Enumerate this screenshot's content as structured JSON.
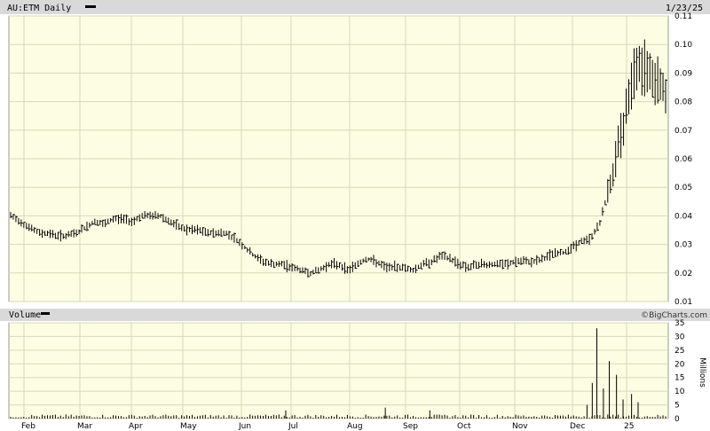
{
  "header": {
    "title": "AU:ETM Daily",
    "date": "1/23/25",
    "volume_label": "Volume",
    "brand": "©BigCharts.com"
  },
  "colors": {
    "plot_bg": "#fdfde3",
    "grid": "#d8d8b8",
    "bar_band": "#d8d8d8",
    "price_bar": "#000000"
  },
  "chart_data": [
    {
      "type": "ohlc",
      "title": "AU:ETM Daily",
      "grid": true,
      "y_axis_side": "right",
      "ylim": [
        0.01,
        0.11
      ],
      "yticks": [
        "0.01",
        "0.02",
        "0.03",
        "0.04",
        "0.05",
        "0.06",
        "0.07",
        "0.08",
        "0.09",
        "0.10",
        "0.11"
      ],
      "xticks": [
        "Feb",
        "Mar",
        "Apr",
        "May",
        "Jun",
        "Jul",
        "Aug",
        "Sep",
        "Oct",
        "Nov",
        "Dec",
        "25"
      ],
      "weekly_close": [
        0.04,
        0.038,
        0.036,
        0.034,
        0.034,
        0.033,
        0.033,
        0.034,
        0.036,
        0.038,
        0.037,
        0.039,
        0.039,
        0.038,
        0.04,
        0.04,
        0.04,
        0.038,
        0.036,
        0.035,
        0.035,
        0.034,
        0.034,
        0.034,
        0.032,
        0.029,
        0.026,
        0.024,
        0.023,
        0.023,
        0.022,
        0.021,
        0.02,
        0.021,
        0.023,
        0.023,
        0.021,
        0.023,
        0.025,
        0.024,
        0.022,
        0.022,
        0.022,
        0.021,
        0.023,
        0.024,
        0.026,
        0.025,
        0.023,
        0.022,
        0.023,
        0.023,
        0.023,
        0.023,
        0.024,
        0.024,
        0.024,
        0.025,
        0.027,
        0.027,
        0.029,
        0.031,
        0.032,
        0.038,
        0.05,
        0.065,
        0.08,
        0.095,
        0.09,
        0.088,
        0.083
      ]
    },
    {
      "type": "bar",
      "title": "Volume",
      "ylabel": "Millions",
      "ylim": [
        0,
        35
      ],
      "yticks": [
        "0",
        "5",
        "10",
        "15",
        "20",
        "25",
        "30",
        "35"
      ],
      "spikes": [
        {
          "x": 0.88,
          "value": 5
        },
        {
          "x": 0.888,
          "value": 13
        },
        {
          "x": 0.895,
          "value": 33
        },
        {
          "x": 0.905,
          "value": 11
        },
        {
          "x": 0.914,
          "value": 21
        },
        {
          "x": 0.925,
          "value": 16
        },
        {
          "x": 0.935,
          "value": 7
        },
        {
          "x": 0.948,
          "value": 9
        },
        {
          "x": 0.958,
          "value": 6
        },
        {
          "x": 0.572,
          "value": 4
        },
        {
          "x": 0.42,
          "value": 3
        },
        {
          "x": 0.64,
          "value": 3
        }
      ]
    }
  ]
}
